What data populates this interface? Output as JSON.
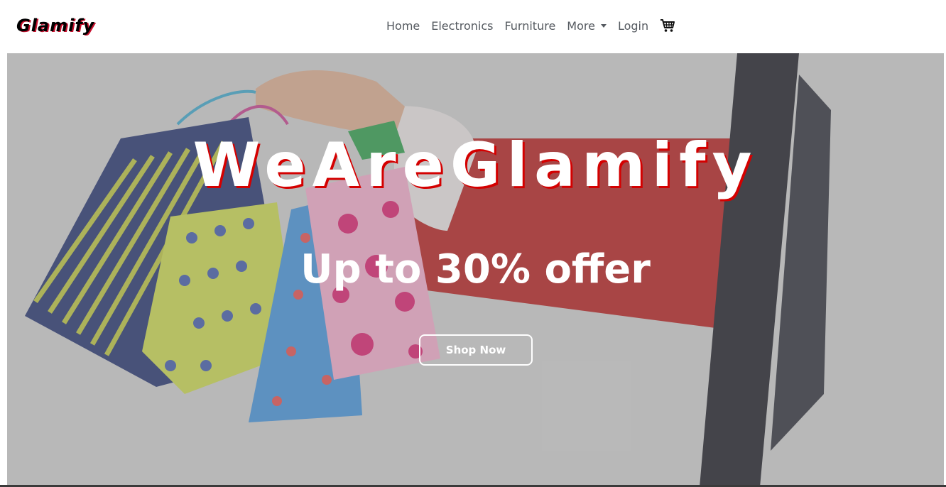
{
  "brand": {
    "name": "Glamify"
  },
  "nav": {
    "items": [
      {
        "label": "Home"
      },
      {
        "label": "Electronics"
      },
      {
        "label": "Furniture"
      },
      {
        "label": "More"
      },
      {
        "label": "Login"
      }
    ],
    "cart_icon": "shopping-cart-icon"
  },
  "hero": {
    "title": "WeAreGlamify",
    "subtitle": "Up to 30% offer",
    "button_label": "Shop Now"
  },
  "colors": {
    "brand_shadow": "#c8102e",
    "title_shadow": "#d40000",
    "nav_text": "#555a60"
  }
}
